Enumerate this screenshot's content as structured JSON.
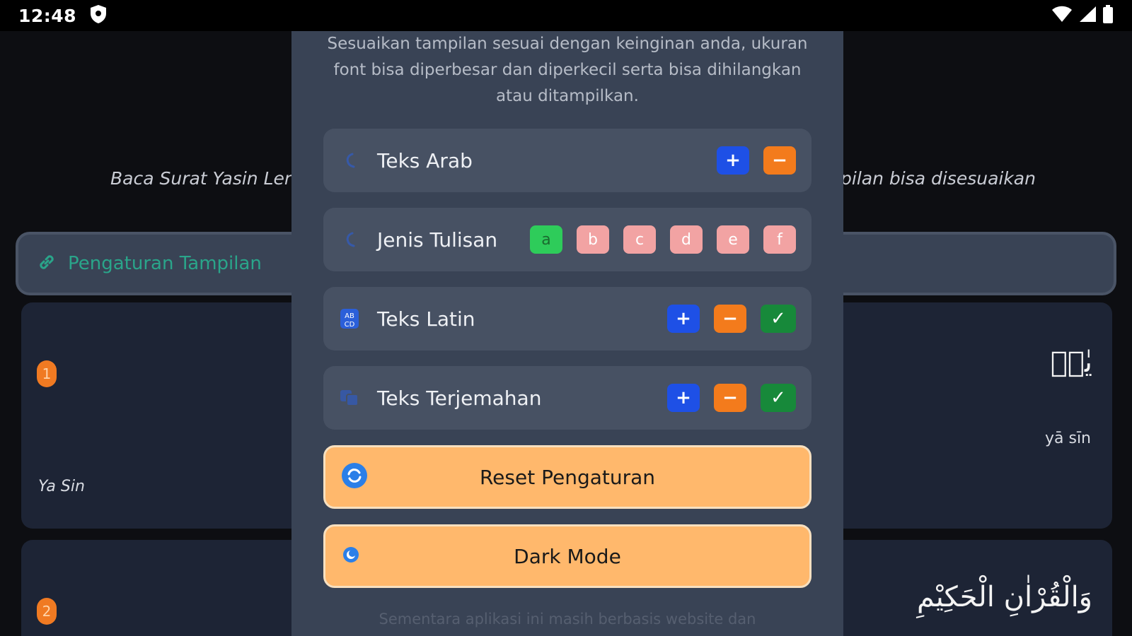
{
  "status_bar": {
    "time": "12:48",
    "icons": [
      "shield-icon",
      "wifi-icon",
      "signal-icon",
      "battery-icon"
    ]
  },
  "background": {
    "subtitle_left": "Baca Surat Yasin Leng",
    "subtitle_right": "pilan bisa disesuaikan",
    "settings_bar_label": "Pengaturan Tampilan",
    "verses": [
      {
        "number": "1",
        "latin_title": "Ya Sin",
        "arabic": "يٰسۤ",
        "transliteration": "yā sīn"
      },
      {
        "number": "2",
        "arabic": "وَالْقُرْاٰنِ الْحَكِيْمِ"
      }
    ]
  },
  "modal": {
    "description": "Sesuaikan tampilan sesuai dengan keinginan anda, ukuran font bisa diperbesar dan diperkecil serta bisa dihilangkan atau ditampilkan.",
    "rows": {
      "teks_arab": {
        "label": "Teks Arab",
        "plus": "+",
        "minus": "−"
      },
      "jenis_tulisan": {
        "label": "Jenis Tulisan",
        "options": [
          "a",
          "b",
          "c",
          "d",
          "e",
          "f"
        ],
        "selected": "a"
      },
      "teks_latin": {
        "label": "Teks Latin",
        "plus": "+",
        "minus": "−",
        "check": "✓"
      },
      "teks_terjemahan": {
        "label": "Teks Terjemahan",
        "plus": "+",
        "minus": "−",
        "check": "✓"
      }
    },
    "reset_label": "Reset Pengaturan",
    "dark_mode_label": "Dark Mode",
    "footer": "Sementara aplikasi ini masih berbasis website dan"
  },
  "colors": {
    "modal_bg": "#394355",
    "row_bg": "#475163",
    "plus": "#1e50e6",
    "minus": "#f37b1c",
    "check": "#17893a",
    "action_button": "#ffb86c",
    "selected_font": "#2ecc5a",
    "unselected_font": "#f2a3a3",
    "accent_link": "#2aa58a"
  }
}
